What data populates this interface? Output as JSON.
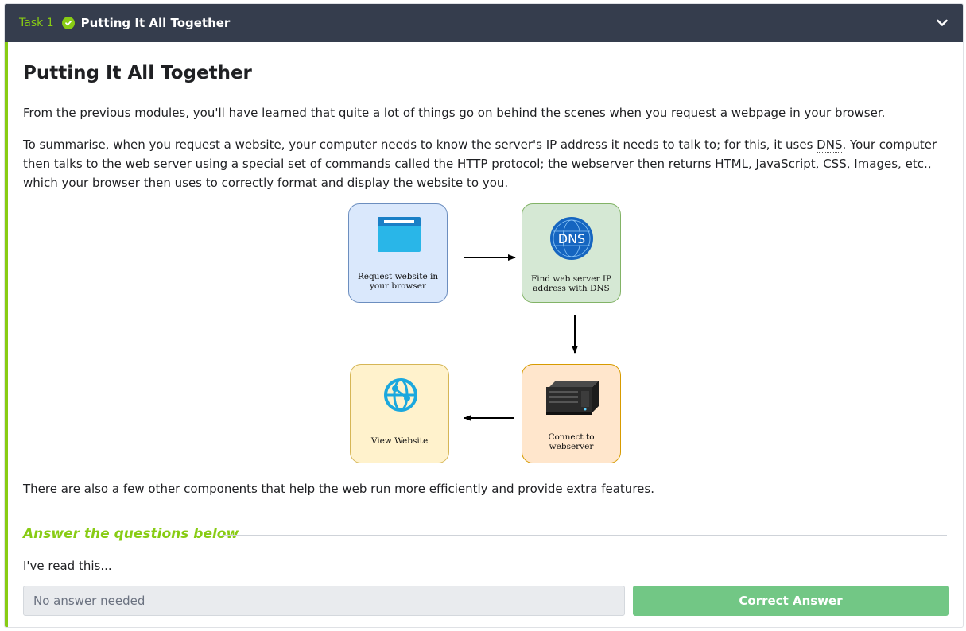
{
  "header": {
    "task_label": "Task 1",
    "title": "Putting It All Together"
  },
  "content": {
    "heading": "Putting It All Together",
    "intro": "From the previous modules, you'll have learned that quite a lot of things go on behind the scenes when you request a webpage in your browser.",
    "summary_before": "To summarise, when you request a website, your computer needs to know the server's IP address it needs to talk to; for this, it uses ",
    "summary_abbr": "DNS",
    "summary_after": ". Your computer then talks to the web server using a special set of commands called the HTTP protocol; the webserver then returns HTML, JavaScript, CSS, Images, etc., which your browser then uses to correctly format and display the website to you.",
    "closing": "There are also a few other components that help the web run more efficiently and provide extra features."
  },
  "diagram": {
    "steps": [
      {
        "label": "Request website in your browser",
        "icon": "browser-window-icon"
      },
      {
        "label": "Find web server IP address with DNS",
        "icon": "dns-globe-icon",
        "icon_text": "DNS"
      },
      {
        "label": "Connect to webserver",
        "icon": "server-icon"
      },
      {
        "label": "View Website",
        "icon": "web-globe-icon"
      }
    ]
  },
  "answers": {
    "section_heading": "Answer the questions below",
    "question": "I've read this...",
    "answer_placeholder": "No answer needed",
    "button_label": "Correct Answer"
  },
  "colors": {
    "header_bg": "#353d4d",
    "accent_green": "#88cc14",
    "button_green": "#72c785"
  }
}
